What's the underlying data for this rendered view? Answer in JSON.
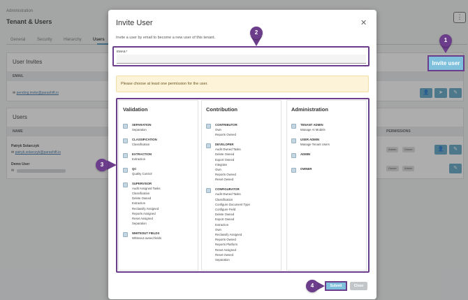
{
  "background": {
    "breadcrumb": "Administration",
    "title": "Tenant & Users",
    "tabs": [
      "General",
      "Security",
      "Hierarchy",
      "Users"
    ],
    "invites_panel": {
      "heading": "User Invites",
      "column": "EMAIL",
      "row_email": "pending.invite@parashift.io"
    },
    "users_panel": {
      "heading": "Users",
      "column_name": "NAME",
      "column_permissions": "PERMISSIONS",
      "rows": [
        {
          "name": "Patryk Solarczyk",
          "email": "patryk.solarczyk@parashift.io",
          "roles": [
            "Admin",
            "Owner"
          ]
        },
        {
          "name": "Demo User",
          "email": "",
          "roles": [
            "Owner",
            "Admin"
          ]
        }
      ]
    },
    "invite_button": "Invite user"
  },
  "modal": {
    "title": "Invite User",
    "subtitle": "Invite a user by email to become a new user of this tenant.",
    "email_label": "EMAIL*",
    "email_value": "",
    "warning": "Please choose at least one permission for the user.",
    "columns": [
      {
        "title": "Validation",
        "permissions": [
          {
            "name": "SEPARATION",
            "subs": [
              "Separation"
            ]
          },
          {
            "name": "CLASSIFICATION",
            "subs": [
              "Classification"
            ]
          },
          {
            "name": "EXTRACTION",
            "subs": [
              "Extraction"
            ]
          },
          {
            "name": "QC",
            "subs": [
              "Quality Control"
            ]
          },
          {
            "name": "SUPERVISOR",
            "subs": [
              "Audit Assigned Tasks",
              "Classification",
              "Delete Owned",
              "Extraction",
              "Reclassify Assigned",
              "Reports Assigned",
              "Reset Assigned",
              "Separation"
            ]
          },
          {
            "name": "WHITEOUT FIELDS",
            "subs": [
              "Whiteout owned fields"
            ]
          }
        ]
      },
      {
        "title": "Contribution",
        "permissions": [
          {
            "name": "CONTRIBUTOR",
            "subs": [
              "Own",
              "Reports Owned"
            ]
          },
          {
            "name": "DEVELOPER",
            "subs": [
              "Audit Owned Tasks",
              "Delete Owned",
              "Export Owned",
              "Integrate",
              "Own",
              "Reports Owned",
              "Reset Owned"
            ]
          },
          {
            "name": "CONFIGURATOR",
            "subs": [
              "Audit Owned Tasks",
              "Classification",
              "Configure Document Type",
              "Configure Field",
              "Delete Owned",
              "Export Owned",
              "Extraction",
              "Own",
              "Reclassify Assigned",
              "Reports Owned",
              "Reports Platform",
              "Reset Assigned",
              "Reset Owned",
              "Separation"
            ]
          }
        ]
      },
      {
        "title": "Administration",
        "permissions": [
          {
            "name": "TENANT ADMIN",
            "subs": [
              "Manage AI Models"
            ]
          },
          {
            "name": "USER ADMIN",
            "subs": [
              "Manage Tenant Users"
            ]
          },
          {
            "name": "ADMIN",
            "subs": []
          },
          {
            "name": "OWNER",
            "subs": []
          }
        ]
      }
    ],
    "submit": "Submit",
    "close": "Close"
  },
  "callouts": [
    "1",
    "2",
    "3",
    "4"
  ],
  "icons": {
    "close": "close-icon",
    "kebab": "kebab-menu-icon",
    "mail": "mail-icon"
  },
  "colors": {
    "accent": "#7fc1dc",
    "highlight": "#6b3d8a",
    "warning_bg": "#fcf3d8"
  }
}
